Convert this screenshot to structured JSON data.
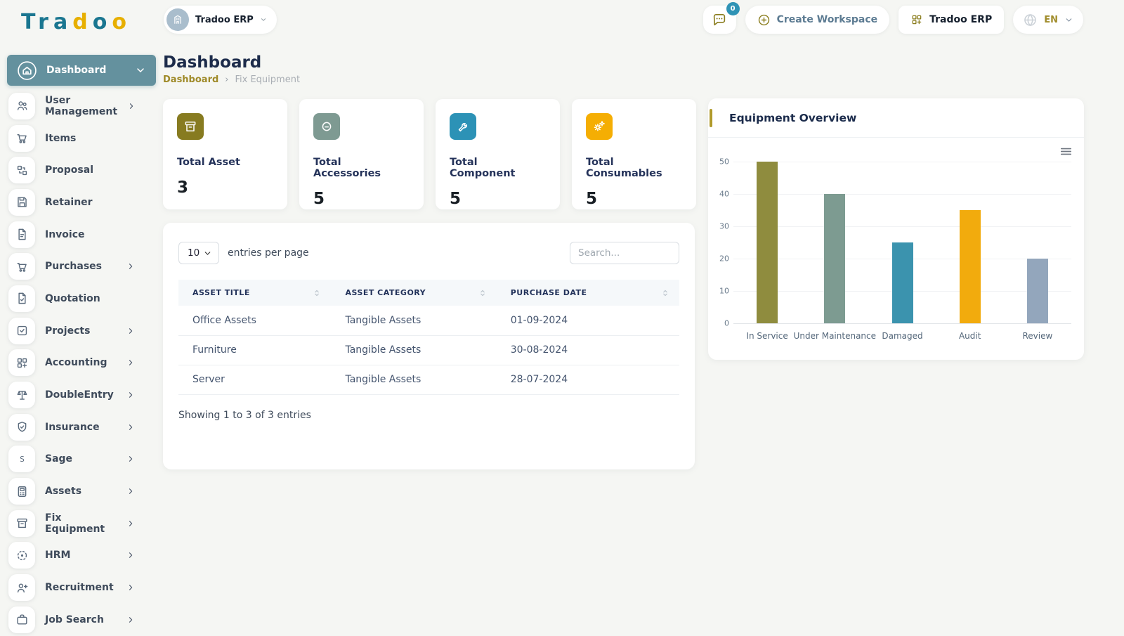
{
  "brand": {
    "logo_letters": [
      {
        "ch": "T",
        "color": "#1a7690"
      },
      {
        "ch": "r",
        "color": "#1a7690"
      },
      {
        "ch": "a",
        "color": "#1a7690"
      },
      {
        "ch": "d",
        "color": "#e7af00"
      },
      {
        "ch": "o",
        "color": "#1a7690"
      },
      {
        "ch": "o",
        "color": "#e7af00"
      }
    ]
  },
  "topbar": {
    "workspace_pill": {
      "label": "Tradoo ERP"
    },
    "chat_badge": "0",
    "create_workspace_label": "Create Workspace",
    "workspace_button_label": "Tradoo ERP",
    "language": "EN"
  },
  "sidebar": {
    "active_item": {
      "label": "Dashboard",
      "icon": "home-icon"
    },
    "items": [
      {
        "label": "User Management",
        "icon": "users-icon",
        "chevron": true
      },
      {
        "label": "Items",
        "icon": "cart-icon",
        "chevron": false
      },
      {
        "label": "Proposal",
        "icon": "qr-icon",
        "chevron": false
      },
      {
        "label": "Retainer",
        "icon": "save-icon",
        "chevron": false
      },
      {
        "label": "Invoice",
        "icon": "file-icon",
        "chevron": false
      },
      {
        "label": "Purchases",
        "icon": "cart-icon",
        "chevron": true
      },
      {
        "label": "Quotation",
        "icon": "file-check-icon",
        "chevron": false
      },
      {
        "label": "Projects",
        "icon": "check-square-icon",
        "chevron": true
      },
      {
        "label": "Accounting",
        "icon": "grid-plus-icon",
        "chevron": true
      },
      {
        "label": "DoubleEntry",
        "icon": "scales-icon",
        "chevron": true
      },
      {
        "label": "Insurance",
        "icon": "shield-check-icon",
        "chevron": true
      },
      {
        "label": "Sage",
        "icon": "letter-s-icon",
        "chevron": true
      },
      {
        "label": "Assets",
        "icon": "calculator-icon",
        "chevron": true
      },
      {
        "label": "Fix Equipment",
        "icon": "archive-icon",
        "chevron": true
      },
      {
        "label": "HRM",
        "icon": "dots-circle-icon",
        "chevron": true
      },
      {
        "label": "Recruitment",
        "icon": "user-plus-icon",
        "chevron": true
      },
      {
        "label": "Job Search",
        "icon": "briefcase-icon",
        "chevron": true
      }
    ]
  },
  "main": {
    "title": "Dashboard",
    "breadcrumb": {
      "current": "Dashboard",
      "separator": "›",
      "page": "Fix Equipment"
    },
    "stats": [
      {
        "label": "Total Asset",
        "value": "3",
        "icon": "archive-box-icon",
        "color": "#877b20"
      },
      {
        "label": "Total Accessories",
        "value": "5",
        "icon": "accessories-icon",
        "color": "#7e9a92"
      },
      {
        "label": "Total Component",
        "value": "5",
        "icon": "wrench-icon",
        "color": "#2c92b6"
      },
      {
        "label": "Total Consumables",
        "value": "5",
        "icon": "cogs-icon",
        "color": "#f5ae03"
      }
    ],
    "table": {
      "page_size": "10",
      "entries_label": "entries per page",
      "search_placeholder": "Search...",
      "columns": [
        "ASSET TITLE",
        "ASSET CATEGORY",
        "PURCHASE DATE"
      ],
      "rows": [
        {
          "title": "Office Assets",
          "category": "Tangible Assets",
          "date": "01-09-2024"
        },
        {
          "title": "Furniture",
          "category": "Tangible Assets",
          "date": "30-08-2024"
        },
        {
          "title": "Server",
          "category": "Tangible Assets",
          "date": "28-07-2024"
        }
      ],
      "footer": "Showing 1 to 3 of 3 entries"
    }
  },
  "chart_card": {
    "title": "Equipment Overview"
  },
  "chart_data": {
    "type": "bar",
    "title": "Equipment Overview",
    "categories": [
      "In Service",
      "Under Maintenance",
      "Damaged",
      "Audit",
      "Review"
    ],
    "values": [
      50,
      40,
      25,
      35,
      20
    ],
    "colors": [
      "#8f8c3e",
      "#7d9b91",
      "#3b93ae",
      "#f2ab0d",
      "#93a6bc"
    ],
    "xlabel": "",
    "ylabel": "",
    "ylim": [
      0,
      50
    ],
    "ytick_step": 10,
    "grid": true,
    "legend": false
  }
}
